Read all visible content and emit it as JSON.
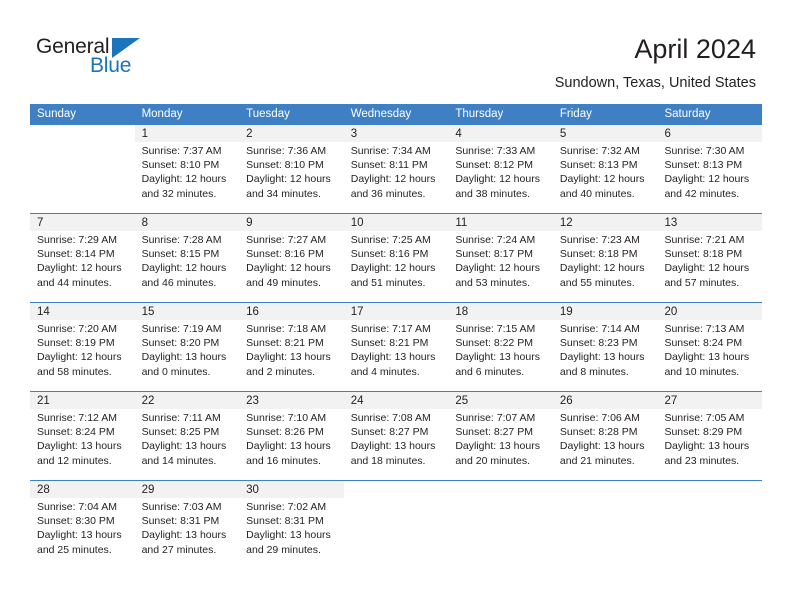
{
  "brand": {
    "name_part1": "General",
    "name_part2": "Blue",
    "accent_color": "#1b75bc",
    "triangle_icon": "triangle-icon"
  },
  "header": {
    "title": "April 2024",
    "subtitle": "Sundown, Texas, United States"
  },
  "calendar": {
    "header_color": "#3f80c4",
    "daynum_band_color": "#f2f2f2",
    "weekdays": [
      "Sunday",
      "Monday",
      "Tuesday",
      "Wednesday",
      "Thursday",
      "Friday",
      "Saturday"
    ],
    "weeks": [
      [
        {
          "day": "",
          "blank": true,
          "sunrise": "",
          "sunset": "",
          "daylight_line1": "",
          "daylight_line2": ""
        },
        {
          "day": "1",
          "sunrise": "Sunrise: 7:37 AM",
          "sunset": "Sunset: 8:10 PM",
          "daylight_line1": "Daylight: 12 hours",
          "daylight_line2": "and 32 minutes."
        },
        {
          "day": "2",
          "sunrise": "Sunrise: 7:36 AM",
          "sunset": "Sunset: 8:10 PM",
          "daylight_line1": "Daylight: 12 hours",
          "daylight_line2": "and 34 minutes."
        },
        {
          "day": "3",
          "sunrise": "Sunrise: 7:34 AM",
          "sunset": "Sunset: 8:11 PM",
          "daylight_line1": "Daylight: 12 hours",
          "daylight_line2": "and 36 minutes."
        },
        {
          "day": "4",
          "sunrise": "Sunrise: 7:33 AM",
          "sunset": "Sunset: 8:12 PM",
          "daylight_line1": "Daylight: 12 hours",
          "daylight_line2": "and 38 minutes."
        },
        {
          "day": "5",
          "sunrise": "Sunrise: 7:32 AM",
          "sunset": "Sunset: 8:13 PM",
          "daylight_line1": "Daylight: 12 hours",
          "daylight_line2": "and 40 minutes."
        },
        {
          "day": "6",
          "sunrise": "Sunrise: 7:30 AM",
          "sunset": "Sunset: 8:13 PM",
          "daylight_line1": "Daylight: 12 hours",
          "daylight_line2": "and 42 minutes."
        }
      ],
      [
        {
          "day": "7",
          "sunrise": "Sunrise: 7:29 AM",
          "sunset": "Sunset: 8:14 PM",
          "daylight_line1": "Daylight: 12 hours",
          "daylight_line2": "and 44 minutes."
        },
        {
          "day": "8",
          "sunrise": "Sunrise: 7:28 AM",
          "sunset": "Sunset: 8:15 PM",
          "daylight_line1": "Daylight: 12 hours",
          "daylight_line2": "and 46 minutes."
        },
        {
          "day": "9",
          "sunrise": "Sunrise: 7:27 AM",
          "sunset": "Sunset: 8:16 PM",
          "daylight_line1": "Daylight: 12 hours",
          "daylight_line2": "and 49 minutes."
        },
        {
          "day": "10",
          "sunrise": "Sunrise: 7:25 AM",
          "sunset": "Sunset: 8:16 PM",
          "daylight_line1": "Daylight: 12 hours",
          "daylight_line2": "and 51 minutes."
        },
        {
          "day": "11",
          "sunrise": "Sunrise: 7:24 AM",
          "sunset": "Sunset: 8:17 PM",
          "daylight_line1": "Daylight: 12 hours",
          "daylight_line2": "and 53 minutes."
        },
        {
          "day": "12",
          "sunrise": "Sunrise: 7:23 AM",
          "sunset": "Sunset: 8:18 PM",
          "daylight_line1": "Daylight: 12 hours",
          "daylight_line2": "and 55 minutes."
        },
        {
          "day": "13",
          "sunrise": "Sunrise: 7:21 AM",
          "sunset": "Sunset: 8:18 PM",
          "daylight_line1": "Daylight: 12 hours",
          "daylight_line2": "and 57 minutes."
        }
      ],
      [
        {
          "day": "14",
          "sunrise": "Sunrise: 7:20 AM",
          "sunset": "Sunset: 8:19 PM",
          "daylight_line1": "Daylight: 12 hours",
          "daylight_line2": "and 58 minutes."
        },
        {
          "day": "15",
          "sunrise": "Sunrise: 7:19 AM",
          "sunset": "Sunset: 8:20 PM",
          "daylight_line1": "Daylight: 13 hours",
          "daylight_line2": "and 0 minutes."
        },
        {
          "day": "16",
          "sunrise": "Sunrise: 7:18 AM",
          "sunset": "Sunset: 8:21 PM",
          "daylight_line1": "Daylight: 13 hours",
          "daylight_line2": "and 2 minutes."
        },
        {
          "day": "17",
          "sunrise": "Sunrise: 7:17 AM",
          "sunset": "Sunset: 8:21 PM",
          "daylight_line1": "Daylight: 13 hours",
          "daylight_line2": "and 4 minutes."
        },
        {
          "day": "18",
          "sunrise": "Sunrise: 7:15 AM",
          "sunset": "Sunset: 8:22 PM",
          "daylight_line1": "Daylight: 13 hours",
          "daylight_line2": "and 6 minutes."
        },
        {
          "day": "19",
          "sunrise": "Sunrise: 7:14 AM",
          "sunset": "Sunset: 8:23 PM",
          "daylight_line1": "Daylight: 13 hours",
          "daylight_line2": "and 8 minutes."
        },
        {
          "day": "20",
          "sunrise": "Sunrise: 7:13 AM",
          "sunset": "Sunset: 8:24 PM",
          "daylight_line1": "Daylight: 13 hours",
          "daylight_line2": "and 10 minutes."
        }
      ],
      [
        {
          "day": "21",
          "sunrise": "Sunrise: 7:12 AM",
          "sunset": "Sunset: 8:24 PM",
          "daylight_line1": "Daylight: 13 hours",
          "daylight_line2": "and 12 minutes."
        },
        {
          "day": "22",
          "sunrise": "Sunrise: 7:11 AM",
          "sunset": "Sunset: 8:25 PM",
          "daylight_line1": "Daylight: 13 hours",
          "daylight_line2": "and 14 minutes."
        },
        {
          "day": "23",
          "sunrise": "Sunrise: 7:10 AM",
          "sunset": "Sunset: 8:26 PM",
          "daylight_line1": "Daylight: 13 hours",
          "daylight_line2": "and 16 minutes."
        },
        {
          "day": "24",
          "sunrise": "Sunrise: 7:08 AM",
          "sunset": "Sunset: 8:27 PM",
          "daylight_line1": "Daylight: 13 hours",
          "daylight_line2": "and 18 minutes."
        },
        {
          "day": "25",
          "sunrise": "Sunrise: 7:07 AM",
          "sunset": "Sunset: 8:27 PM",
          "daylight_line1": "Daylight: 13 hours",
          "daylight_line2": "and 20 minutes."
        },
        {
          "day": "26",
          "sunrise": "Sunrise: 7:06 AM",
          "sunset": "Sunset: 8:28 PM",
          "daylight_line1": "Daylight: 13 hours",
          "daylight_line2": "and 21 minutes."
        },
        {
          "day": "27",
          "sunrise": "Sunrise: 7:05 AM",
          "sunset": "Sunset: 8:29 PM",
          "daylight_line1": "Daylight: 13 hours",
          "daylight_line2": "and 23 minutes."
        }
      ],
      [
        {
          "day": "28",
          "sunrise": "Sunrise: 7:04 AM",
          "sunset": "Sunset: 8:30 PM",
          "daylight_line1": "Daylight: 13 hours",
          "daylight_line2": "and 25 minutes."
        },
        {
          "day": "29",
          "sunrise": "Sunrise: 7:03 AM",
          "sunset": "Sunset: 8:31 PM",
          "daylight_line1": "Daylight: 13 hours",
          "daylight_line2": "and 27 minutes."
        },
        {
          "day": "30",
          "sunrise": "Sunrise: 7:02 AM",
          "sunset": "Sunset: 8:31 PM",
          "daylight_line1": "Daylight: 13 hours",
          "daylight_line2": "and 29 minutes."
        },
        {
          "day": "",
          "blank": true,
          "sunrise": "",
          "sunset": "",
          "daylight_line1": "",
          "daylight_line2": ""
        },
        {
          "day": "",
          "blank": true,
          "sunrise": "",
          "sunset": "",
          "daylight_line1": "",
          "daylight_line2": ""
        },
        {
          "day": "",
          "blank": true,
          "sunrise": "",
          "sunset": "",
          "daylight_line1": "",
          "daylight_line2": ""
        },
        {
          "day": "",
          "blank": true,
          "sunrise": "",
          "sunset": "",
          "daylight_line1": "",
          "daylight_line2": ""
        }
      ]
    ]
  }
}
